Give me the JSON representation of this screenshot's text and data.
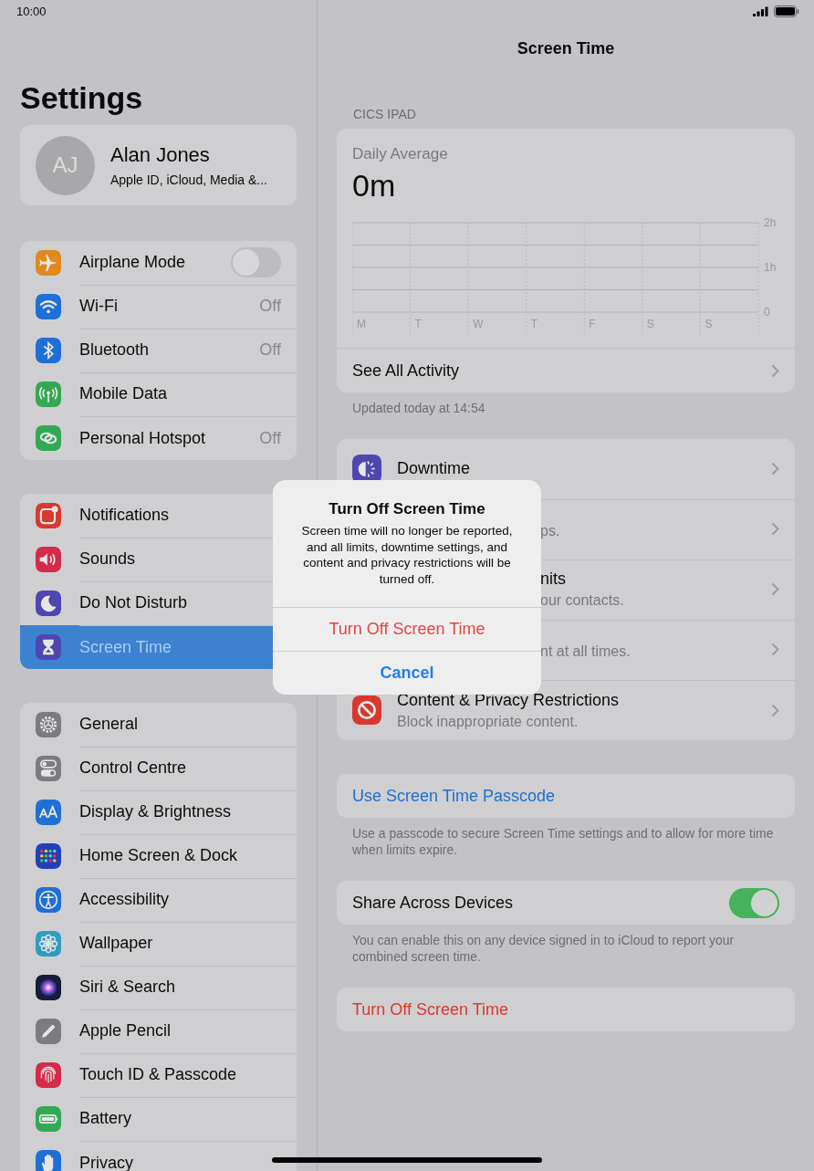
{
  "status_bar": {
    "time": "10:00"
  },
  "sidebar": {
    "title": "Settings",
    "profile": {
      "initials": "AJ",
      "name": "Alan Jones",
      "subtitle": "Apple ID, iCloud, Media &..."
    },
    "groups": [
      [
        {
          "label": "Airplane Mode",
          "color": "#e0891c",
          "selected": false,
          "toggle": {
            "on": false
          }
        },
        {
          "label": "Wi-Fi",
          "color": "#1f6fd6",
          "selected": false,
          "value": "Off"
        },
        {
          "label": "Bluetooth",
          "color": "#1f6fd6",
          "selected": false,
          "value": "Off"
        },
        {
          "label": "Mobile Data",
          "color": "#34a853",
          "selected": false
        },
        {
          "label": "Personal Hotspot",
          "color": "#34a853",
          "selected": false,
          "value": "Off"
        }
      ],
      [
        {
          "label": "Notifications",
          "color": "#d8392f",
          "selected": false
        },
        {
          "label": "Sounds",
          "color": "#d32c4a",
          "selected": false
        },
        {
          "label": "Do Not Disturb",
          "color": "#4e47b0",
          "selected": false
        },
        {
          "label": "Screen Time",
          "color": "#4e47b0",
          "selected": true
        }
      ],
      [
        {
          "label": "General",
          "color": "#7b7b80",
          "selected": false
        },
        {
          "label": "Control Centre",
          "color": "#7b7b80",
          "selected": false
        },
        {
          "label": "Display & Brightness",
          "color": "#1f6fd6",
          "selected": false
        },
        {
          "label": "Home Screen & Dock",
          "color": "#2340b8",
          "selected": false
        },
        {
          "label": "Accessibility",
          "color": "#1f6fd6",
          "selected": false
        },
        {
          "label": "Wallpaper",
          "color": "#2f9cc4",
          "selected": false
        },
        {
          "label": "Siri & Search",
          "color": "#1a1a3a",
          "selected": false
        },
        {
          "label": "Apple Pencil",
          "color": "#7b7b80",
          "selected": false
        },
        {
          "label": "Touch ID & Passcode",
          "color": "#d32c4a",
          "selected": false
        },
        {
          "label": "Battery",
          "color": "#34a853",
          "selected": false
        },
        {
          "label": "Privacy",
          "color": "#1f6fd6",
          "selected": false
        }
      ]
    ]
  },
  "detail": {
    "title": "Screen Time",
    "section_label": "CICS IPAD",
    "usage": {
      "label": "Daily Average",
      "value": "0m",
      "chart_data": {
        "type": "bar",
        "categories": [
          "M",
          "T",
          "W",
          "T",
          "F",
          "S",
          "S"
        ],
        "values": [
          0,
          0,
          0,
          0,
          0,
          0,
          0
        ],
        "ylim": [
          0,
          2
        ],
        "yticks": [
          {
            "value": 0,
            "label": "0"
          },
          {
            "value": 1,
            "label": "1h"
          },
          {
            "value": 2,
            "label": "2h"
          }
        ]
      },
      "link": "See All Activity",
      "footer": "Updated today at 14:54"
    },
    "features": [
      {
        "kind": "full",
        "title": "Downtime",
        "color": "#4e47b0"
      },
      {
        "kind": "covered",
        "subtitle": "ps."
      },
      {
        "kind": "covered",
        "title": "nits",
        "subtitle": "our contacts."
      },
      {
        "kind": "covered",
        "subtitle": "nt at all times."
      },
      {
        "kind": "full",
        "title": "Content & Privacy Restrictions",
        "subtitle": "Block inappropriate content.",
        "color": "#d8392f"
      }
    ],
    "passcode": {
      "label": "Use Screen Time Passcode",
      "footer": "Use a passcode to secure Screen Time settings and to allow for more time when limits expire."
    },
    "share": {
      "label": "Share Across Devices",
      "on": true,
      "footer": "You can enable this on any device signed in to iCloud to report your combined screen time."
    },
    "turn_off": "Turn Off Screen Time"
  },
  "alert": {
    "title": "Turn Off Screen Time",
    "message": "Screen time will no longer be reported, and all limits, downtime settings, and content and privacy restrictions will be turned off.",
    "buttons": [
      {
        "label": "Turn Off Screen Time",
        "kind": "destructive"
      },
      {
        "label": "Cancel",
        "kind": "cancel"
      }
    ]
  }
}
